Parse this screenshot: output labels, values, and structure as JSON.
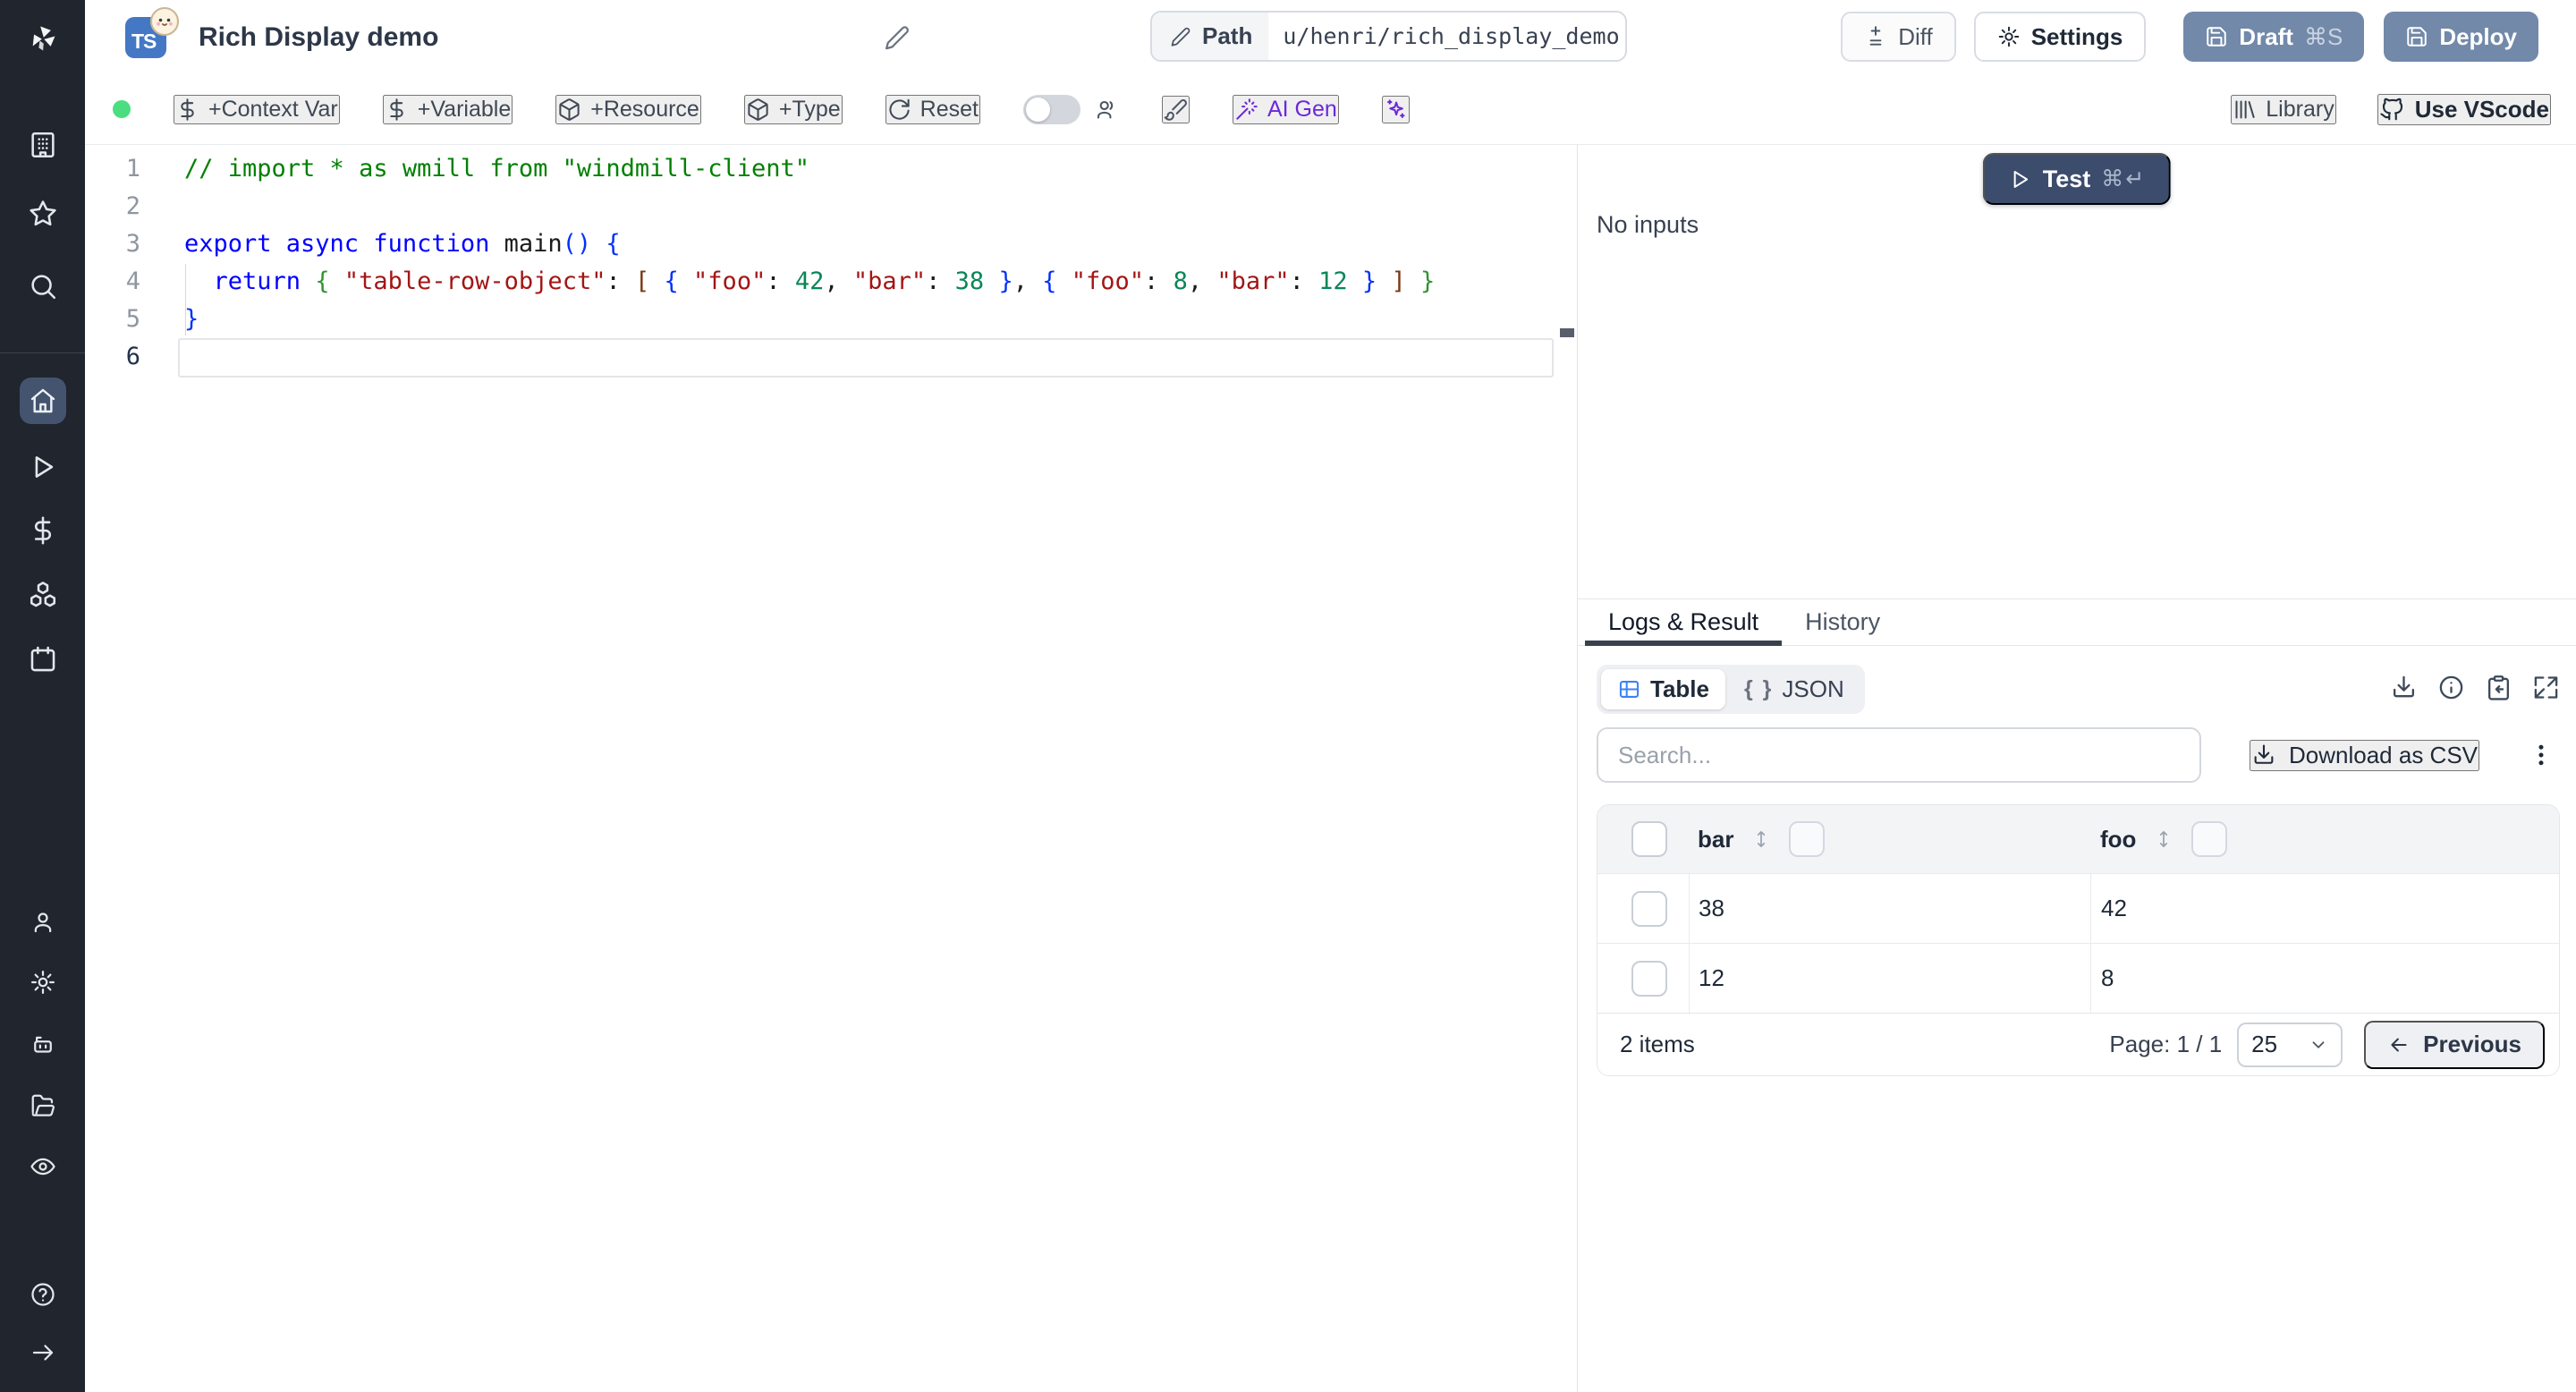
{
  "colors": {
    "sidebar_bg": "#20252e",
    "active_tile": "#44546f",
    "slate_button": "#7289a9",
    "test_button": "#3b4c6d",
    "accent_purple": "#6d28d9",
    "ts_blue": "#4477c4",
    "status_green": "#4ade80",
    "table_icon_blue": "#3b82f6"
  },
  "icons": {
    "sidebar": [
      "windmill-logo",
      "building-icon",
      "star-icon",
      "search-icon",
      "home-icon",
      "play-icon",
      "dollar-icon",
      "cubes-icon",
      "calendar-icon",
      "user-icon",
      "gear-icon",
      "robot-icon",
      "folder-icon",
      "eye-icon",
      "help-icon",
      "arrow-right-icon"
    ],
    "toolbar": [
      "dollar-icon",
      "package-icon",
      "reset-icon",
      "toggle",
      "users-icon",
      "brush-icon",
      "wand-icon",
      "sparkles-icon",
      "library-icon",
      "github-icon"
    ],
    "results": [
      "table-icon",
      "braces-icon",
      "download-icon",
      "info-icon",
      "clipboard-copy-icon",
      "expand-icon",
      "kebab-icon",
      "sort-icon",
      "chevron-down-icon",
      "arrow-left-icon"
    ]
  },
  "header": {
    "ts_badge": "TS",
    "title": "Rich Display demo",
    "path_label": "Path",
    "path_value": "u/henri/rich_display_demo",
    "diff": "Diff",
    "settings": "Settings",
    "draft": "Draft",
    "draft_shortcut": "⌘S",
    "deploy": "Deploy"
  },
  "toolbar": {
    "context_var": "+Context Var",
    "variable": "+Variable",
    "resource": "+Resource",
    "type": "+Type",
    "reset": "Reset",
    "ai_gen": "AI Gen",
    "library": "Library",
    "use_vscode": "Use VScode"
  },
  "editor": {
    "lines": [
      {
        "n": "1",
        "tokens": [
          {
            "c": "comment",
            "t": "// import * as wmill from \"windmill-client\""
          }
        ]
      },
      {
        "n": "2",
        "tokens": []
      },
      {
        "n": "3",
        "tokens": [
          {
            "c": "kw",
            "t": "export async function "
          },
          {
            "c": "plain",
            "t": "main"
          },
          {
            "c": "b1",
            "t": "() {"
          }
        ]
      },
      {
        "n": "4",
        "tokens": [
          {
            "c": "plain",
            "t": "  "
          },
          {
            "c": "kw",
            "t": "return"
          },
          {
            "c": "plain",
            "t": " "
          },
          {
            "c": "b2",
            "t": "{"
          },
          {
            "c": "plain",
            "t": " "
          },
          {
            "c": "str",
            "t": "\"table-row-object\""
          },
          {
            "c": "plain",
            "t": ": "
          },
          {
            "c": "b3",
            "t": "["
          },
          {
            "c": "plain",
            "t": " "
          },
          {
            "c": "b1",
            "t": "{"
          },
          {
            "c": "plain",
            "t": " "
          },
          {
            "c": "str",
            "t": "\"foo\""
          },
          {
            "c": "plain",
            "t": ": "
          },
          {
            "c": "num",
            "t": "42"
          },
          {
            "c": "plain",
            "t": ", "
          },
          {
            "c": "str",
            "t": "\"bar\""
          },
          {
            "c": "plain",
            "t": ": "
          },
          {
            "c": "num",
            "t": "38"
          },
          {
            "c": "plain",
            "t": " "
          },
          {
            "c": "b1",
            "t": "}"
          },
          {
            "c": "plain",
            "t": ", "
          },
          {
            "c": "b1",
            "t": "{"
          },
          {
            "c": "plain",
            "t": " "
          },
          {
            "c": "str",
            "t": "\"foo\""
          },
          {
            "c": "plain",
            "t": ": "
          },
          {
            "c": "num",
            "t": "8"
          },
          {
            "c": "plain",
            "t": ", "
          },
          {
            "c": "str",
            "t": "\"bar\""
          },
          {
            "c": "plain",
            "t": ": "
          },
          {
            "c": "num",
            "t": "12"
          },
          {
            "c": "plain",
            "t": " "
          },
          {
            "c": "b1",
            "t": "}"
          },
          {
            "c": "plain",
            "t": " "
          },
          {
            "c": "b3",
            "t": "]"
          },
          {
            "c": "plain",
            "t": " "
          },
          {
            "c": "b2",
            "t": "}"
          }
        ]
      },
      {
        "n": "5",
        "tokens": [
          {
            "c": "b1",
            "t": "}"
          }
        ]
      },
      {
        "n": "6",
        "tokens": [],
        "current": true
      }
    ]
  },
  "run": {
    "test": "Test",
    "shortcut": "⌘↵",
    "no_inputs": "No inputs"
  },
  "results": {
    "tabs": [
      {
        "label": "Logs & Result"
      },
      {
        "label": "History"
      }
    ],
    "views": [
      {
        "label": "Table"
      },
      {
        "label": "JSON"
      }
    ],
    "search_placeholder": "Search...",
    "download_csv": "Download as CSV",
    "table": {
      "columns": [
        "bar",
        "foo"
      ],
      "rows": [
        [
          "38",
          "42"
        ],
        [
          "12",
          "8"
        ]
      ],
      "items_label": "2 items",
      "page_label": "Page: 1 / 1",
      "page_size": "25",
      "prev": "Previous"
    }
  }
}
